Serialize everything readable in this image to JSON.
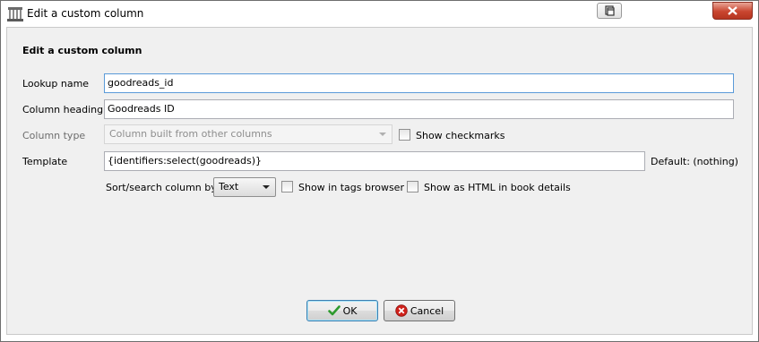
{
  "window": {
    "title": "Edit a custom column"
  },
  "form": {
    "heading": "Edit a custom column",
    "lookup_name": {
      "label": "Lookup name",
      "value": "goodreads_id"
    },
    "column_heading": {
      "label": "Column heading",
      "value": "Goodreads ID"
    },
    "column_type": {
      "label": "Column type",
      "value": "Column built from other columns"
    },
    "show_checkmarks": {
      "label": "Show checkmarks",
      "checked": false
    },
    "template": {
      "label": "Template",
      "value": "{identifiers:select(goodreads)}",
      "default_text": "Default: (nothing)"
    },
    "sort_search": {
      "label": "Sort/search column by",
      "value": "Text"
    },
    "show_in_tags_browser": {
      "label": "Show in tags browser",
      "checked": false
    },
    "show_as_html": {
      "label": "Show as HTML in book details",
      "checked": false
    }
  },
  "buttons": {
    "ok": "OK",
    "cancel": "Cancel"
  },
  "colors": {
    "ok_icon": "#2e9a2e",
    "cancel_icon": "#d0201a",
    "client_bg": "#f0f0f0"
  }
}
